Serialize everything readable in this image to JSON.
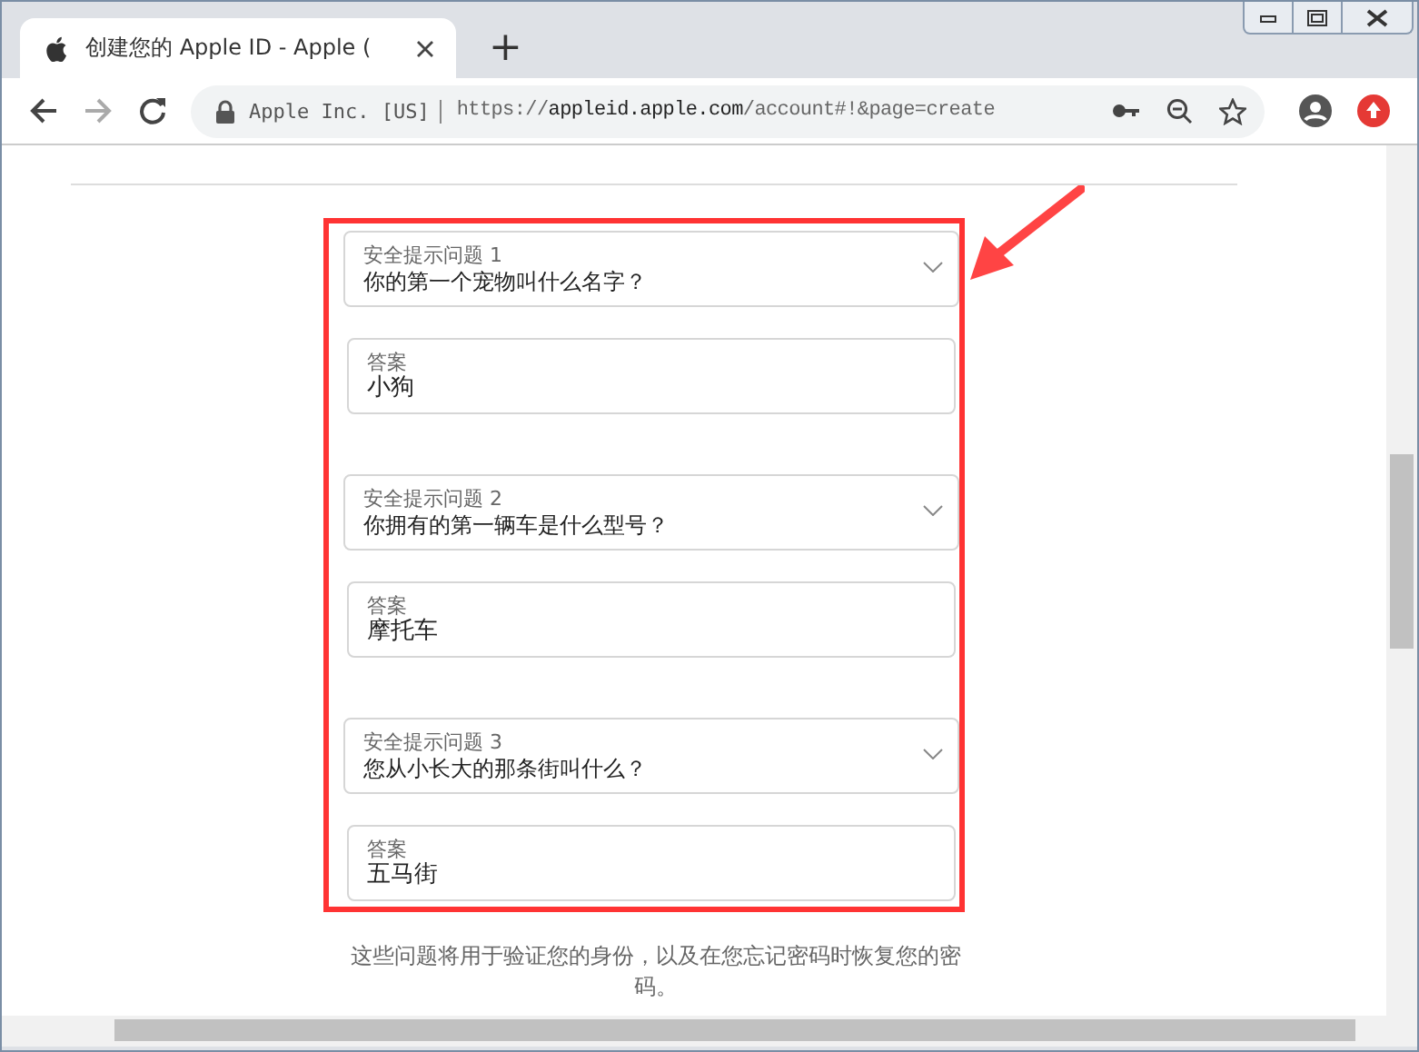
{
  "browser": {
    "tab": {
      "title": "创建您的 Apple ID - Apple (",
      "selected": true
    },
    "new_tab": "+",
    "address": {
      "site_label": "Apple Inc. [US]",
      "scheme": "https://",
      "host": "appleid.apple.com",
      "path": "/account#!&page=create"
    }
  },
  "form": {
    "highlighted": true,
    "questions": [
      {
        "label": "安全提示问题 1",
        "question": "你的第一个宠物叫什么名字？",
        "answer_label": "答案",
        "answer": "小狗"
      },
      {
        "label": "安全提示问题 2",
        "question": "你拥有的第一辆车是什么型号？",
        "answer_label": "答案",
        "answer": "摩托车"
      },
      {
        "label": "安全提示问题 3",
        "question": "您从小长大的那条街叫什么？",
        "answer_label": "答案",
        "answer": "五马街"
      }
    ],
    "note": "这些问题将用于验证您的身份，以及在您忘记密码时恢复您的密码。"
  }
}
